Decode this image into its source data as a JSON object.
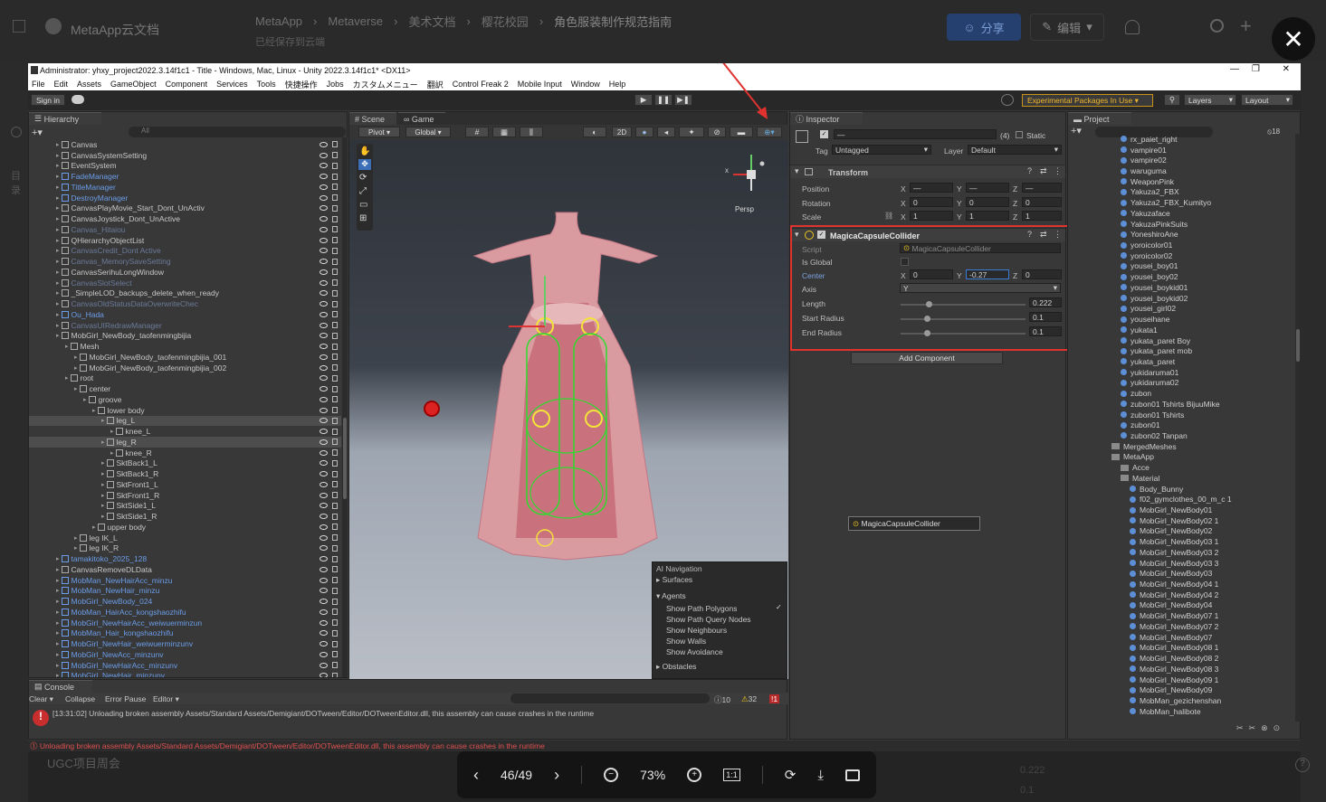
{
  "doc": {
    "app_name": "MetaApp云文档",
    "breadcrumb": [
      "MetaApp",
      "Metaverse",
      "美术文档",
      "樱花校园",
      "角色服装制作规范指南"
    ],
    "saved_status": "已经保存到云端",
    "share_label": "分享",
    "edit_label": "编辑",
    "side_label": "目录",
    "bottom_title": "UGC项目周会",
    "bottom_values": [
      "0.222",
      "0.1"
    ]
  },
  "viewer": {
    "page": "46/49",
    "zoom": "73%"
  },
  "unity": {
    "title": "Administrator: yhxy_project2022.3.14f1c1 - Title - Windows, Mac, Linux - Unity 2022.3.14f1c1* <DX11>",
    "menu": [
      "File",
      "Edit",
      "Assets",
      "GameObject",
      "Component",
      "Services",
      "Tools",
      "快捷操作",
      "Jobs",
      "カスタムメニュー",
      "翻訳",
      "Control Freak 2",
      "Mobile Input",
      "Window",
      "Help"
    ],
    "toolbar": {
      "sign_in": "Sign in",
      "experimental": "Experimental Packages In Use ▾",
      "layers": "Layers",
      "layout": "Layout"
    },
    "hierarchy": {
      "tab": "Hierarchy",
      "search_placeholder": "All",
      "rows": [
        {
          "name": "Canvas",
          "indent": 3,
          "style": ""
        },
        {
          "name": "CanvasSystemSetting",
          "indent": 3,
          "style": ""
        },
        {
          "name": "EventSystem",
          "indent": 3,
          "style": ""
        },
        {
          "name": "FadeManager",
          "indent": 3,
          "style": "blue"
        },
        {
          "name": "TitleManager",
          "indent": 3,
          "style": "blue"
        },
        {
          "name": "DestroyManager",
          "indent": 3,
          "style": "blue"
        },
        {
          "name": "CanvasPlayMovie_Start_Dont_UnActiv",
          "indent": 3,
          "style": ""
        },
        {
          "name": "CanvasJoystick_Dont_UnActive",
          "indent": 3,
          "style": ""
        },
        {
          "name": "Canvas_Hitaiou",
          "indent": 3,
          "style": "dim"
        },
        {
          "name": "QHierarchyObjectList",
          "indent": 3,
          "style": ""
        },
        {
          "name": "CanvasCredit_Dont Active",
          "indent": 3,
          "style": "dim"
        },
        {
          "name": "Canvas_MemorySaveSetting",
          "indent": 3,
          "style": "dim"
        },
        {
          "name": "CanvasSerihuLongWindow",
          "indent": 3,
          "style": ""
        },
        {
          "name": "CanvasSlotSelect",
          "indent": 3,
          "style": "dim"
        },
        {
          "name": "_SimpleLOD_backups_delete_when_ready",
          "indent": 3,
          "style": ""
        },
        {
          "name": "CanvasOldStatusDataOverwriteChec",
          "indent": 3,
          "style": "dim"
        },
        {
          "name": "Ou_Hada",
          "indent": 3,
          "style": "blue"
        },
        {
          "name": "CanvasUIRedrawManager",
          "indent": 3,
          "style": "dim"
        },
        {
          "name": "MobGirl_NewBody_taofenmingbijia",
          "indent": 3,
          "style": ""
        },
        {
          "name": "Mesh",
          "indent": 4,
          "style": ""
        },
        {
          "name": "MobGirl_NewBody_taofenmingbijia_001",
          "indent": 5,
          "style": ""
        },
        {
          "name": "MobGirl_NewBody_taofenmingbijia_002",
          "indent": 5,
          "style": ""
        },
        {
          "name": "root",
          "indent": 4,
          "style": ""
        },
        {
          "name": "center",
          "indent": 5,
          "style": ""
        },
        {
          "name": "groove",
          "indent": 6,
          "style": ""
        },
        {
          "name": "lower body",
          "indent": 7,
          "style": ""
        },
        {
          "name": "leg_L",
          "indent": 8,
          "style": "sel"
        },
        {
          "name": "knee_L",
          "indent": 9,
          "style": ""
        },
        {
          "name": "leg_R",
          "indent": 8,
          "style": "sel"
        },
        {
          "name": "knee_R",
          "indent": 9,
          "style": ""
        },
        {
          "name": "SktBack1_L",
          "indent": 8,
          "style": ""
        },
        {
          "name": "SktBack1_R",
          "indent": 8,
          "style": ""
        },
        {
          "name": "SktFront1_L",
          "indent": 8,
          "style": ""
        },
        {
          "name": "SktFront1_R",
          "indent": 8,
          "style": ""
        },
        {
          "name": "SktSide1_L",
          "indent": 8,
          "style": ""
        },
        {
          "name": "SktSide1_R",
          "indent": 8,
          "style": ""
        },
        {
          "name": "upper body",
          "indent": 7,
          "style": ""
        },
        {
          "name": "leg IK_L",
          "indent": 5,
          "style": ""
        },
        {
          "name": "leg IK_R",
          "indent": 5,
          "style": ""
        },
        {
          "name": "tamakitoko_2025_128",
          "indent": 3,
          "style": "blue"
        },
        {
          "name": "CanvasRemoveDLData",
          "indent": 3,
          "style": ""
        },
        {
          "name": "MobMan_NewHairAcc_minzu",
          "indent": 3,
          "style": "blue"
        },
        {
          "name": "MobMan_NewHair_minzu",
          "indent": 3,
          "style": "blue"
        },
        {
          "name": "MobGirl_NewBody_024",
          "indent": 3,
          "style": "blue"
        },
        {
          "name": "MobMan_HairAcc_kongshaozhifu",
          "indent": 3,
          "style": "blue"
        },
        {
          "name": "MobGirl_NewHairAcc_weiwuerminzun",
          "indent": 3,
          "style": "blue"
        },
        {
          "name": "MobMan_Hair_kongshaozhifu",
          "indent": 3,
          "style": "blue"
        },
        {
          "name": "MobGirl_NewHair_weiwuerminzunv",
          "indent": 3,
          "style": "blue"
        },
        {
          "name": "MobGirl_NewAcc_minzunv",
          "indent": 3,
          "style": "blue"
        },
        {
          "name": "MobGirl_NewHairAcc_minzunv",
          "indent": 3,
          "style": "blue"
        },
        {
          "name": "MobGirl_NewHair_minzunv",
          "indent": 3,
          "style": "blue"
        }
      ]
    },
    "scene": {
      "tab_scene": "Scene",
      "tab_game": "Game",
      "pivot": "Pivot",
      "global": "Global",
      "mode_2d": "2D",
      "persp": "Persp",
      "nav_menu": {
        "title": "AI Navigation",
        "items": [
          "Surfaces",
          "Agents",
          "Show Path Polygons",
          "Show Path Query Nodes",
          "Show Neighbours",
          "Show Walls",
          "Show Avoidance",
          "Obstacles"
        ]
      }
    },
    "inspector": {
      "tab": "Inspector",
      "static_label": "Static",
      "layer_count": "(4)",
      "tag_label": "Tag",
      "tag_value": "Untagged",
      "layer_label": "Layer",
      "layer_value": "Default",
      "transform": {
        "title": "Transform",
        "position_label": "Position",
        "rotation_label": "Rotation",
        "scale_label": "Scale",
        "pos": [
          "—",
          "—",
          "—"
        ],
        "rot": [
          "0",
          "0",
          "0"
        ],
        "scale": [
          "1",
          "1",
          "1"
        ]
      },
      "collider": {
        "title": "MagicaCapsuleCollider",
        "script_label": "Script",
        "script_value": "MagicaCapsuleCollider",
        "is_global_label": "Is Global",
        "center_label": "Center",
        "center": [
          "0",
          "-0.27",
          "0"
        ],
        "axis_label": "Axis",
        "axis_value": "Y",
        "length_label": "Length",
        "length_value": "0.222",
        "start_radius_label": "Start Radius",
        "start_radius_value": "0.1",
        "end_radius_label": "End Radius",
        "end_radius_value": "0.1"
      },
      "add_component": "Add Component",
      "dragged_item": "MagicaCapsuleCollider"
    },
    "project": {
      "tab": "Project",
      "count_badge": "18",
      "rows": [
        {
          "name": "rx_paiet_right",
          "type": "file",
          "indent": 1
        },
        {
          "name": "vampire01",
          "type": "file",
          "indent": 1
        },
        {
          "name": "vampire02",
          "type": "file",
          "indent": 1
        },
        {
          "name": "waruguma",
          "type": "file",
          "indent": 1
        },
        {
          "name": "WeaponPink",
          "type": "file",
          "indent": 1
        },
        {
          "name": "Yakuza2_FBX",
          "type": "file",
          "indent": 1
        },
        {
          "name": "Yakuza2_FBX_Kumityo",
          "type": "file",
          "indent": 1
        },
        {
          "name": "Yakuzaface",
          "type": "file",
          "indent": 1
        },
        {
          "name": "YakuzaPinkSuits",
          "type": "file",
          "indent": 1
        },
        {
          "name": "YoneshiroAne",
          "type": "file",
          "indent": 1
        },
        {
          "name": "yoroicolor01",
          "type": "file",
          "indent": 1
        },
        {
          "name": "yoroicolor02",
          "type": "file",
          "indent": 1
        },
        {
          "name": "yousei_boy01",
          "type": "file",
          "indent": 1
        },
        {
          "name": "yousei_boy02",
          "type": "file",
          "indent": 1
        },
        {
          "name": "yousei_boykid01",
          "type": "file",
          "indent": 1
        },
        {
          "name": "yousei_boykid02",
          "type": "file",
          "indent": 1
        },
        {
          "name": "yousei_girl02",
          "type": "file",
          "indent": 1
        },
        {
          "name": "youseihane",
          "type": "file",
          "indent": 1
        },
        {
          "name": "yukata1",
          "type": "file",
          "indent": 1
        },
        {
          "name": "yukata_paret Boy",
          "type": "file",
          "indent": 1
        },
        {
          "name": "yukata_paret mob",
          "type": "file",
          "indent": 1
        },
        {
          "name": "yukata_paret",
          "type": "file",
          "indent": 1
        },
        {
          "name": "yukidaruma01",
          "type": "file",
          "indent": 1
        },
        {
          "name": "yukidaruma02",
          "type": "file",
          "indent": 1
        },
        {
          "name": "zubon",
          "type": "file",
          "indent": 1
        },
        {
          "name": "zubon01 Tshirts BijuuMike",
          "type": "file",
          "indent": 1
        },
        {
          "name": "zubon01 Tshirts",
          "type": "file",
          "indent": 1
        },
        {
          "name": "zubon01",
          "type": "file",
          "indent": 1
        },
        {
          "name": "zubon02 Tanpan",
          "type": "file",
          "indent": 1
        },
        {
          "name": "MergedMeshes",
          "type": "folder",
          "indent": 0
        },
        {
          "name": "MetaApp",
          "type": "folder",
          "indent": 0
        },
        {
          "name": "Acce",
          "type": "folder",
          "indent": 1
        },
        {
          "name": "Material",
          "type": "folder",
          "indent": 1
        },
        {
          "name": "Body_Bunny",
          "type": "file",
          "indent": 2
        },
        {
          "name": "f02_gymclothes_00_m_c 1",
          "type": "file",
          "indent": 2
        },
        {
          "name": "MobGirl_NewBody01",
          "type": "file",
          "indent": 2
        },
        {
          "name": "MobGirl_NewBody02 1",
          "type": "file",
          "indent": 2
        },
        {
          "name": "MobGirl_NewBody02",
          "type": "file",
          "indent": 2
        },
        {
          "name": "MobGirl_NewBody03 1",
          "type": "file",
          "indent": 2
        },
        {
          "name": "MobGirl_NewBody03 2",
          "type": "file",
          "indent": 2
        },
        {
          "name": "MobGirl_NewBody03 3",
          "type": "file",
          "indent": 2
        },
        {
          "name": "MobGirl_NewBody03",
          "type": "file",
          "indent": 2
        },
        {
          "name": "MobGirl_NewBody04 1",
          "type": "file",
          "indent": 2
        },
        {
          "name": "MobGirl_NewBody04 2",
          "type": "file",
          "indent": 2
        },
        {
          "name": "MobGirl_NewBody04",
          "type": "file",
          "indent": 2
        },
        {
          "name": "MobGirl_NewBody07 1",
          "type": "file",
          "indent": 2
        },
        {
          "name": "MobGirl_NewBody07 2",
          "type": "file",
          "indent": 2
        },
        {
          "name": "MobGirl_NewBody07",
          "type": "file",
          "indent": 2
        },
        {
          "name": "MobGirl_NewBody08 1",
          "type": "file",
          "indent": 2
        },
        {
          "name": "MobGirl_NewBody08 2",
          "type": "file",
          "indent": 2
        },
        {
          "name": "MobGirl_NewBody08 3",
          "type": "file",
          "indent": 2
        },
        {
          "name": "MobGirl_NewBody09 1",
          "type": "file",
          "indent": 2
        },
        {
          "name": "MobGirl_NewBody09",
          "type": "file",
          "indent": 2
        },
        {
          "name": "MobMan_gezichenshan",
          "type": "file",
          "indent": 2
        },
        {
          "name": "MobMan_halibote",
          "type": "file",
          "indent": 2
        }
      ]
    },
    "console": {
      "tab": "Console",
      "clear": "Clear",
      "collapse": "Collapse",
      "error_pause": "Error Pause",
      "editor": "Editor",
      "count_info": "10",
      "count_warn": "32",
      "count_error": "1",
      "message": "[13:31:02] Unloading broken assembly Assets/Standard Assets/Demigiant/DOTween/Editor/DOTweenEditor.dll, this assembly can cause crashes in the runtime",
      "status_line": "Unloading broken assembly Assets/Standard Assets/Demigiant/DOTween/Editor/DOTweenEditor.dll, this assembly can cause crashes in the runtime"
    }
  },
  "colors": {
    "highlight_red": "#e0322e",
    "accent_blue": "#3d7bd9",
    "unity_bg": "#383838"
  }
}
